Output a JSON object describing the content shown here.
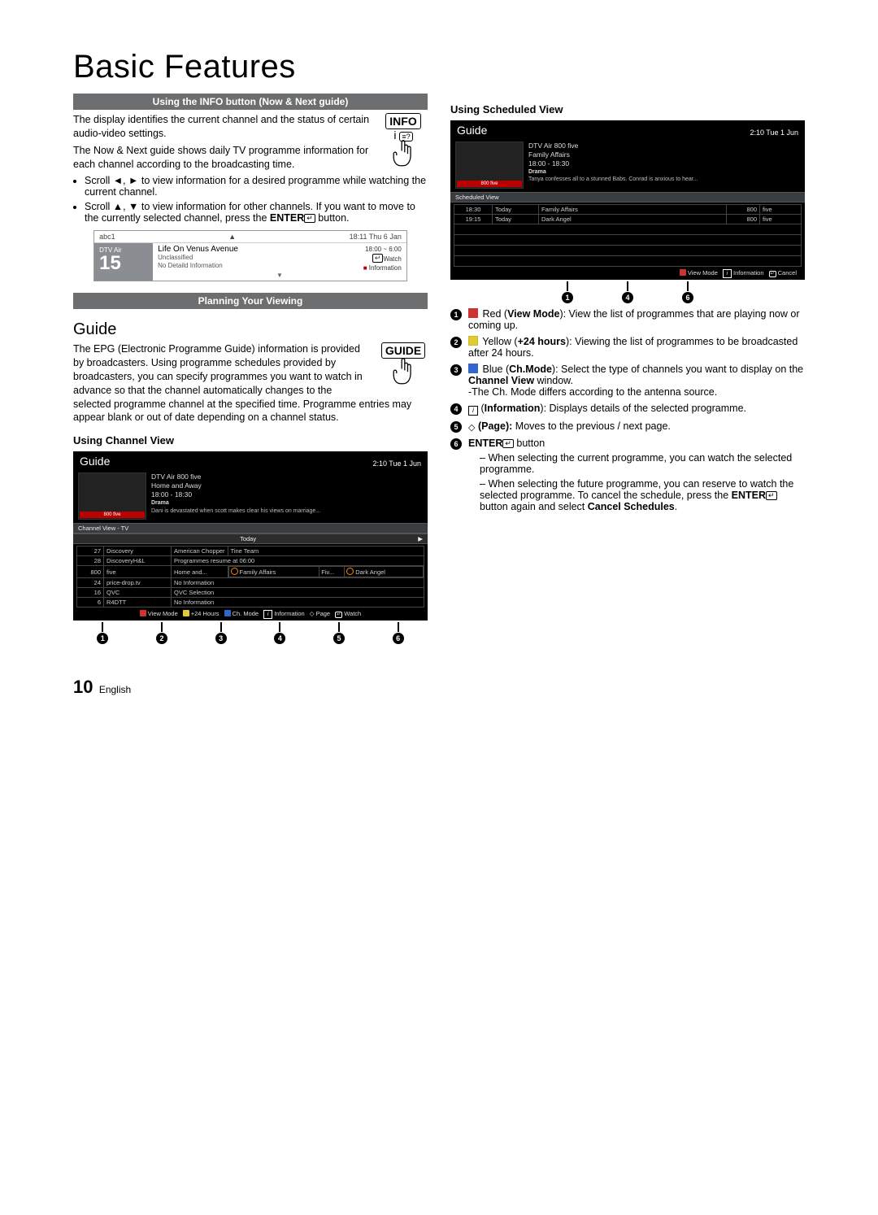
{
  "title": "Basic Features",
  "section_info": "Using the INFO button (Now & Next guide)",
  "section_plan": "Planning Your Viewing",
  "info_button_label": "INFO",
  "guide_button_label": "GUIDE",
  "info_p1": "The display identifies the current channel and the status of certain audio-video settings.",
  "info_p2": "The Now & Next guide shows daily TV programme information for each channel according to the broadcasting time.",
  "info_b1a": "Scroll ◄, ► to view information for a desired programme while watching the current channel.",
  "info_b2a": "Scroll ▲, ▼ to view information for other channels. If you want to move to the currently selected channel, press the ",
  "info_b2b": "ENTER",
  "info_b2c": " button.",
  "info_panel": {
    "top_left": "abc1",
    "top_right": "18:11 Thu 6 Jan",
    "air": "DTV Air",
    "num": "15",
    "title": "Life On Venus Avenue",
    "time": "18:00 ~ 6:00",
    "sub1": "Unclassified",
    "sub2": "No Detaild Information",
    "watch": "Watch",
    "information": "Information"
  },
  "guide_h": "Guide",
  "guide_p1": "The EPG (Electronic Programme Guide) information is provided by broadcasters. Using programme schedules provided by broadcasters, you can specify programmes you want to watch in advance so that the channel automatically changes to the selected programme channel at the specified time. Programme entries may appear blank or out of date depending on a channel status.",
  "using_channel_view": "Using  Channel View",
  "using_scheduled_view": "Using Scheduled View",
  "cv": {
    "title": "Guide",
    "datetime": "2:10 Tue 1 Jun",
    "meta1": "DTV Air 800 five",
    "meta2": "Home and Away",
    "meta3": "18:00 - 18:30",
    "meta4": "Drama",
    "meta5": "Dani is devastated when scott makes clear his views on marriage...",
    "tab": "Channel View - TV",
    "today": "Today",
    "rows": [
      {
        "n": "27",
        "ch": "Discovery",
        "c1": "American Chopper",
        "c2": "Tine Team"
      },
      {
        "n": "28",
        "ch": "DiscoveryH&L",
        "c1": "Programmes resume at 06:00",
        "c2": ""
      },
      {
        "n": "800",
        "ch": "five",
        "c1": "Home and...",
        "c2": "Family Affairs",
        "c3": "Fiv...",
        "c4": "Dark Angel"
      },
      {
        "n": "24",
        "ch": "price-drop.tv",
        "c1": "No Information",
        "c2": ""
      },
      {
        "n": "16",
        "ch": "QVC",
        "c1": "QVC Selection",
        "c2": ""
      },
      {
        "n": "6",
        "ch": "R4DTT",
        "c1": "No Information",
        "c2": ""
      }
    ],
    "legend": {
      "a": "View Mode",
      "b": "+24 Hours",
      "c": "Ch. Mode",
      "d": "Information",
      "e": "Page",
      "f": "Watch"
    }
  },
  "sv": {
    "title": "Guide",
    "datetime": "2:10 Tue 1 Jun",
    "meta1": "DTV Air 800 five",
    "meta2": "Family Affairs",
    "meta3": "18:00 - 18:30",
    "meta4": "Drama",
    "meta5": "Tanya confesses all to a stunned Babs. Conrad is anxious to hear...",
    "tab": "Scheduled View",
    "rows": [
      {
        "t": "18:30",
        "d": "Today",
        "p": "Family Affairs",
        "n": "800",
        "ch": "five"
      },
      {
        "t": "19:15",
        "d": "Today",
        "p": "Dark Angel",
        "n": "800",
        "ch": "five"
      }
    ],
    "legend": {
      "a": "View Mode",
      "d": "Information",
      "f": "Cancel"
    }
  },
  "notes": {
    "n1a": "Red (",
    "n1b": "View Mode",
    "n1c": "): View the list of programmes that are playing now or coming up.",
    "n2a": "Yellow (",
    "n2b": "+24 hours",
    "n2c": "): Viewing the list of programmes to be broadcasted after 24 hours.",
    "n3a": "Blue (",
    "n3b": "Ch.Mode",
    "n3c": "): Select the type of channels you want to display on the ",
    "n3d": "Channel View",
    "n3e": " window.",
    "n3f": "-The Ch. Mode differs according to the antenna source.",
    "n4a": " (",
    "n4b": "Information",
    "n4c": "): Displays details of the selected programme.",
    "n5a": " (Page):",
    "n5b": " Moves to the previous / next page.",
    "n6a": "ENTER",
    "n6b": " button",
    "n6c": "When selecting the current programme, you can watch the selected programme.",
    "n6d": "When selecting the future programme, you can reserve to watch the selected programme. To cancel the schedule, press the ",
    "n6e": "ENTER",
    "n6f": " button again and select ",
    "n6g": "Cancel Schedules",
    "n6h": "."
  },
  "footer": {
    "page": "10",
    "lang": "English"
  }
}
